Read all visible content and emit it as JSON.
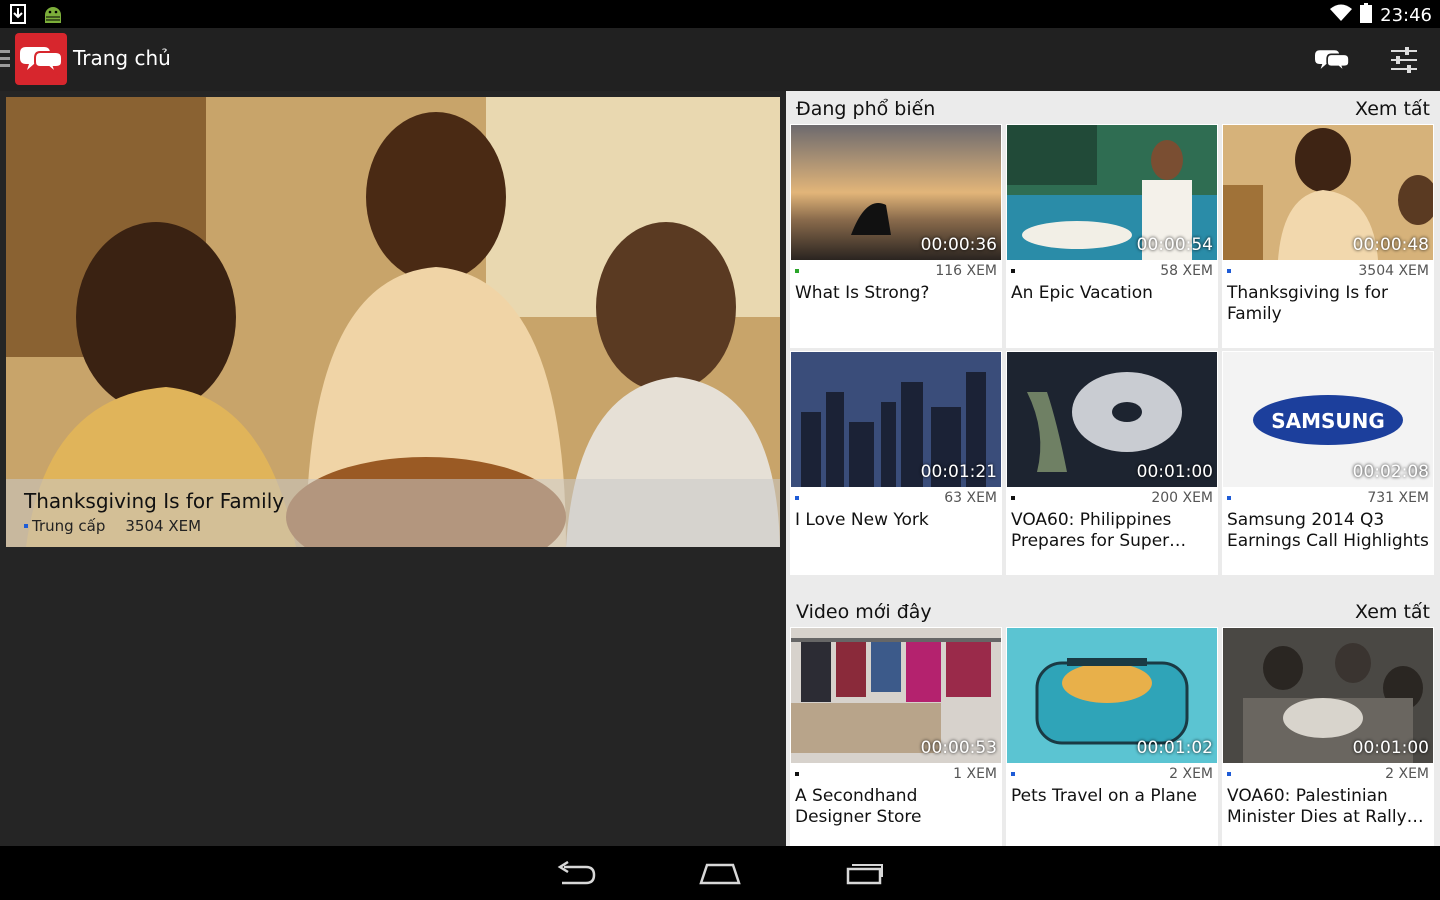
{
  "status_bar": {
    "time": "23:46",
    "icons": [
      "download-icon",
      "android-debug-icon",
      "wifi-icon",
      "battery-icon"
    ]
  },
  "action_bar": {
    "title": "Trang chủ",
    "actions": [
      "chat-bubbles-icon",
      "settings-sliders-icon"
    ]
  },
  "featured": {
    "title": "Thanksgiving Is for Family",
    "level": "Trung cấp",
    "views": "3504 XEM"
  },
  "sections": [
    {
      "title": "Đang phổ biến",
      "see_all": "Xem tất",
      "cards": [
        {
          "duration": "00:00:36",
          "views": "116 XEM",
          "title": "What Is Strong?",
          "dot_color": "#2aa52a"
        },
        {
          "duration": "00:00:54",
          "views": "58 XEM",
          "title": "An Epic Vacation",
          "dot_color": "#111111"
        },
        {
          "duration": "00:00:48",
          "views": "3504 XEM",
          "title": "Thanksgiving Is for Family",
          "dot_color": "#1e5bd6"
        },
        {
          "duration": "00:01:21",
          "views": "63 XEM",
          "title": "I Love New York",
          "dot_color": "#1e5bd6"
        },
        {
          "duration": "00:01:00",
          "views": "200 XEM",
          "title": "VOA60: Philippines Prepares for Super…",
          "dot_color": "#111111"
        },
        {
          "duration": "00:02:08",
          "views": "731 XEM",
          "title": "Samsung 2014 Q3 Earnings Call Highlights",
          "dot_color": "#1e5bd6"
        }
      ]
    },
    {
      "title": "Video mới đây",
      "see_all": "Xem tất",
      "cards": [
        {
          "duration": "00:00:53",
          "views": "1 XEM",
          "title": "A Secondhand Designer Store",
          "dot_color": "#111111"
        },
        {
          "duration": "00:01:02",
          "views": "2 XEM",
          "title": "Pets Travel on a Plane",
          "dot_color": "#1e5bd6"
        },
        {
          "duration": "00:01:00",
          "views": "2 XEM",
          "title": "VOA60: Palestinian Minister Dies at Rally…",
          "dot_color": "#1e5bd6"
        }
      ]
    }
  ],
  "thumbnail_logo_text": "SAMSUNG",
  "nav_bar": [
    "back-icon",
    "home-icon",
    "recents-icon"
  ]
}
